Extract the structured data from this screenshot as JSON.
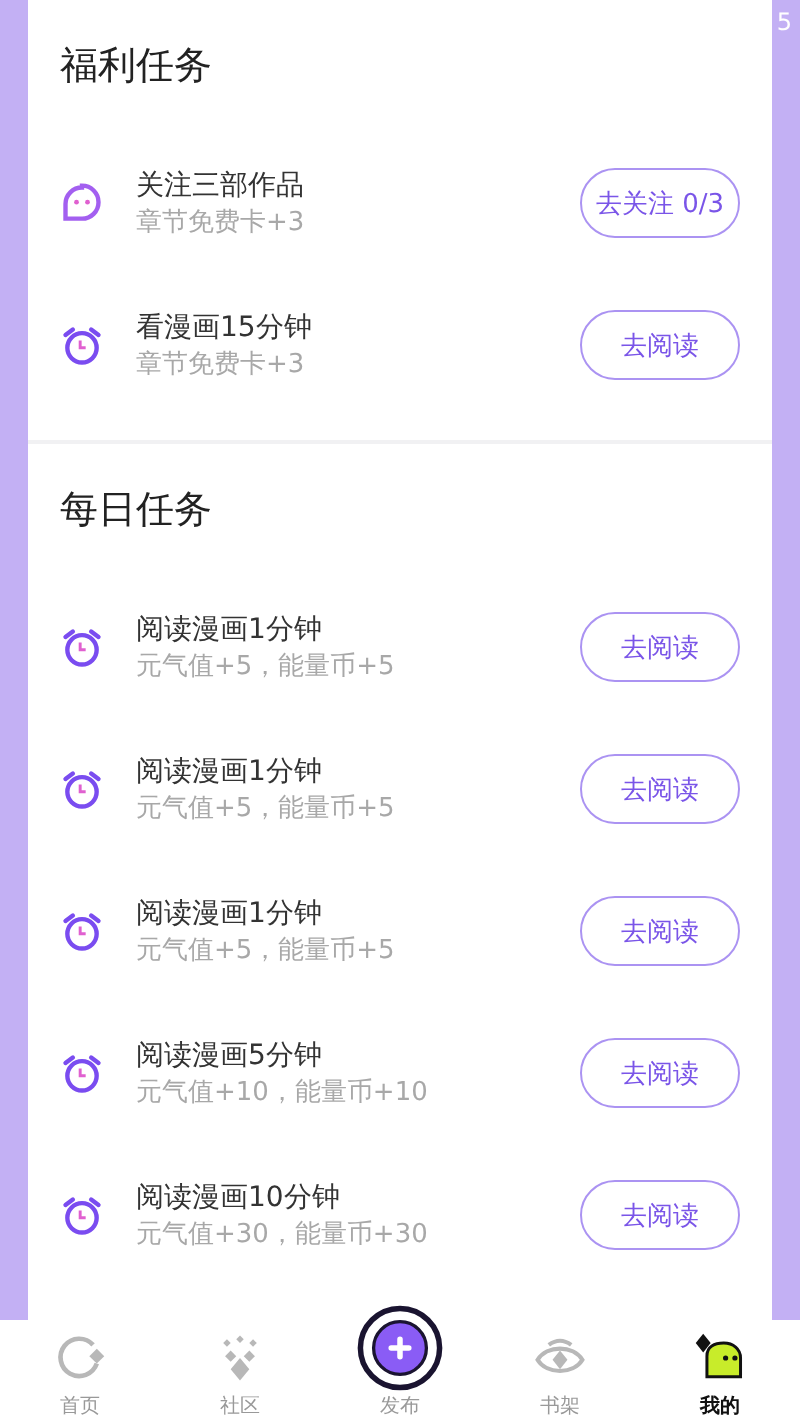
{
  "status_text": "5",
  "sections": [
    {
      "title": "福利任务",
      "tasks": [
        {
          "kind": "chat",
          "title": "关注三部作品",
          "reward": "章节免费卡+3",
          "action": "去关注 0/3"
        },
        {
          "kind": "clock",
          "title": "看漫画15分钟",
          "reward": "章节免费卡+3",
          "action": "去阅读"
        }
      ]
    },
    {
      "title": "每日任务",
      "tasks": [
        {
          "kind": "clock",
          "title": "阅读漫画1分钟",
          "reward": "元气值+5，能量币+5",
          "action": "去阅读"
        },
        {
          "kind": "clock",
          "title": "阅读漫画1分钟",
          "reward": "元气值+5，能量币+5",
          "action": "去阅读"
        },
        {
          "kind": "clock",
          "title": "阅读漫画1分钟",
          "reward": "元气值+5，能量币+5",
          "action": "去阅读"
        },
        {
          "kind": "clock",
          "title": "阅读漫画5分钟",
          "reward": "元气值+10，能量币+10",
          "action": "去阅读"
        },
        {
          "kind": "clock",
          "title": "阅读漫画10分钟",
          "reward": "元气值+30，能量币+30",
          "action": "去阅读"
        }
      ]
    }
  ],
  "tab_bar": [
    {
      "kind": "home",
      "label": "首页",
      "selected": false
    },
    {
      "kind": "community",
      "label": "社区",
      "selected": false
    },
    {
      "kind": "publish",
      "label": "发布",
      "selected": false
    },
    {
      "kind": "shelf",
      "label": "书架",
      "selected": false
    },
    {
      "kind": "me",
      "label": "我的",
      "selected": true
    }
  ]
}
